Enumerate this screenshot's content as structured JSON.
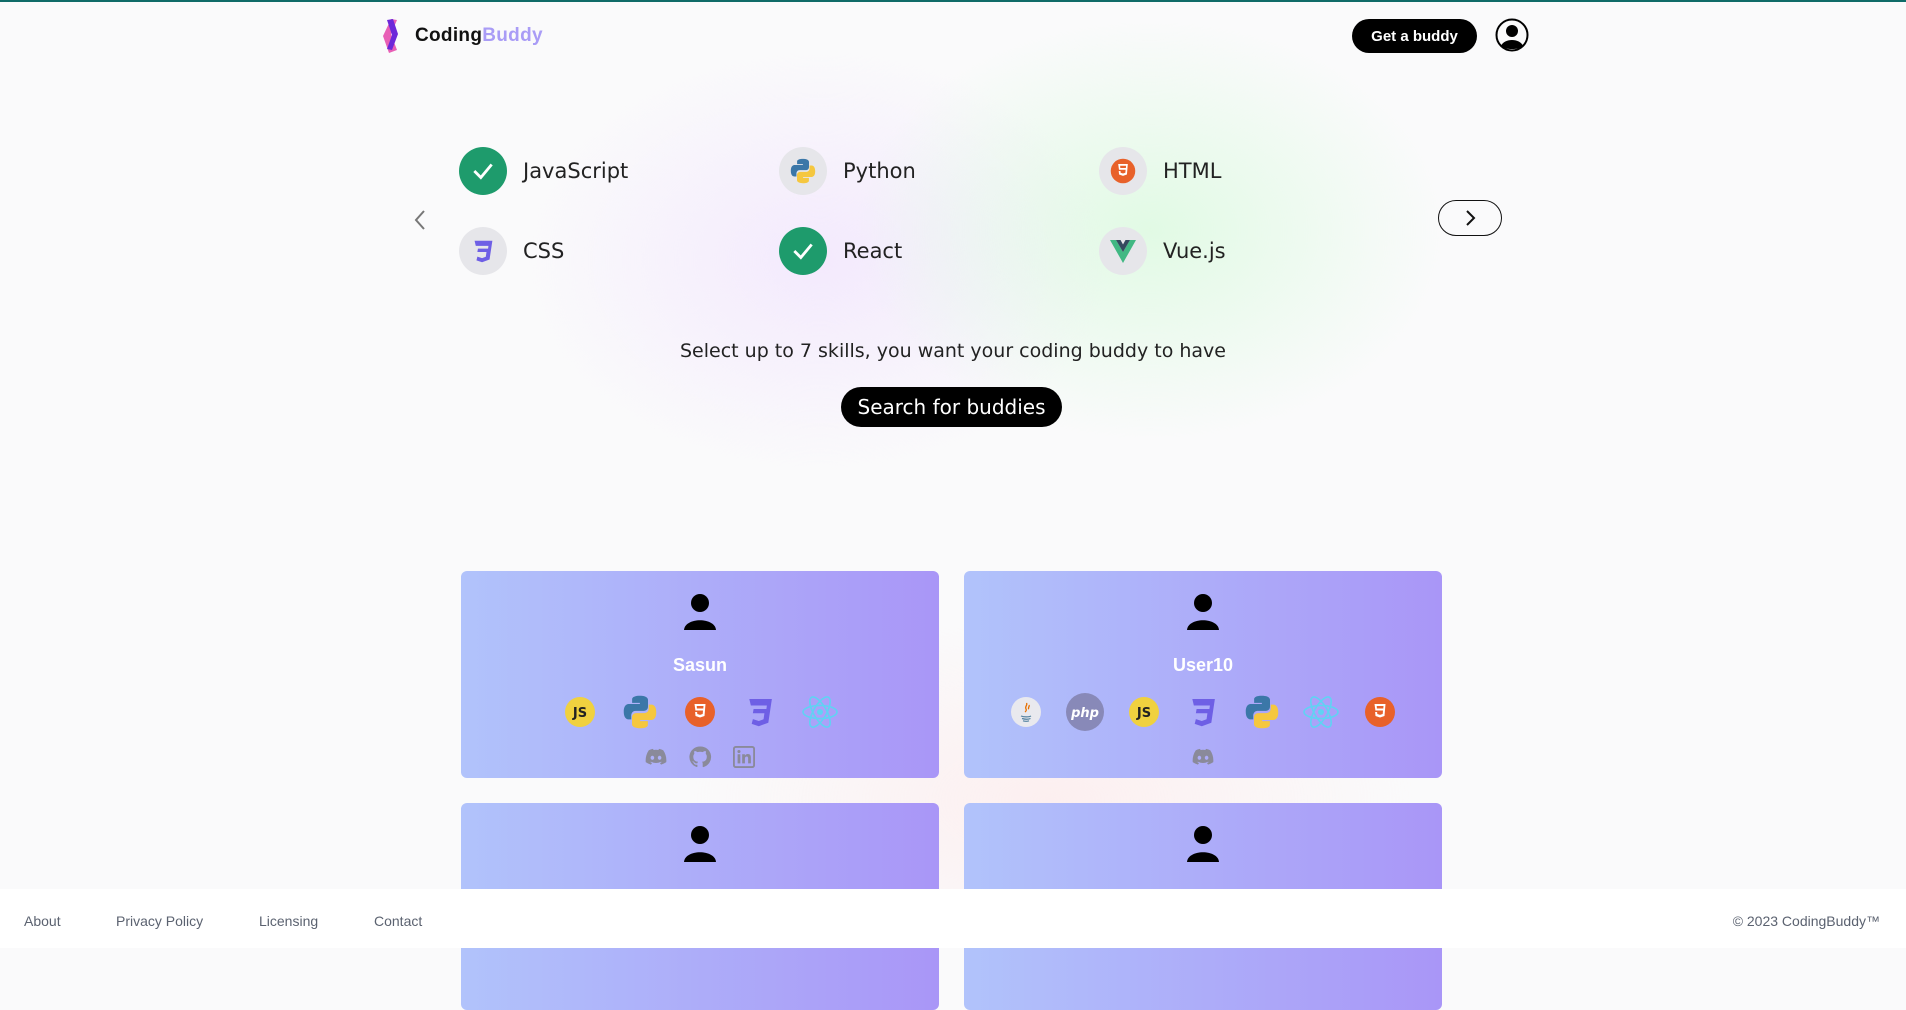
{
  "brand": {
    "name_part1": "Coding",
    "name_part2": "Buddy",
    "accent": "#a99cf6",
    "logo_colors": [
      "#6d28d9",
      "#ec4899"
    ]
  },
  "header": {
    "cta_label": "Get a buddy",
    "profile_icon": "user-circle-icon"
  },
  "skills": [
    {
      "label": "JavaScript",
      "icon": "javascript-icon",
      "selected": true
    },
    {
      "label": "Python",
      "icon": "python-icon",
      "selected": false
    },
    {
      "label": "HTML",
      "icon": "html5-icon",
      "selected": false
    },
    {
      "label": "CSS",
      "icon": "css3-icon",
      "selected": false
    },
    {
      "label": "React",
      "icon": "react-icon",
      "selected": true
    },
    {
      "label": "Vue.js",
      "icon": "vue-icon",
      "selected": false
    }
  ],
  "carousel": {
    "prev_icon": "chevron-left-icon",
    "next_icon": "chevron-right-icon"
  },
  "hint": "Select up to 7 skills, you want your coding buddy to have",
  "search_label": "Search for buddies",
  "cards": [
    {
      "username": "Sasun",
      "skills": [
        "javascript-icon",
        "python-icon",
        "html5-icon",
        "css3-icon",
        "react-icon"
      ],
      "socials": [
        "discord-icon",
        "github-icon",
        "linkedin-icon"
      ]
    },
    {
      "username": "User10",
      "skills": [
        "java-icon",
        "php-icon",
        "javascript-icon",
        "css3-icon",
        "python-icon",
        "react-icon",
        "html5-icon"
      ],
      "socials": [
        "discord-icon"
      ]
    },
    {
      "username": "",
      "skills": [],
      "socials": []
    },
    {
      "username": "",
      "skills": [],
      "socials": []
    }
  ],
  "footer": {
    "links": [
      "About",
      "Privacy Policy",
      "Licensing",
      "Contact"
    ],
    "copyright": "© 2023 CodingBuddy™"
  },
  "colors": {
    "selected_skill": "#1e9b6c",
    "card_gradient": [
      "#b1c3fb",
      "#a996f7"
    ],
    "topline": "#0f6b68"
  }
}
